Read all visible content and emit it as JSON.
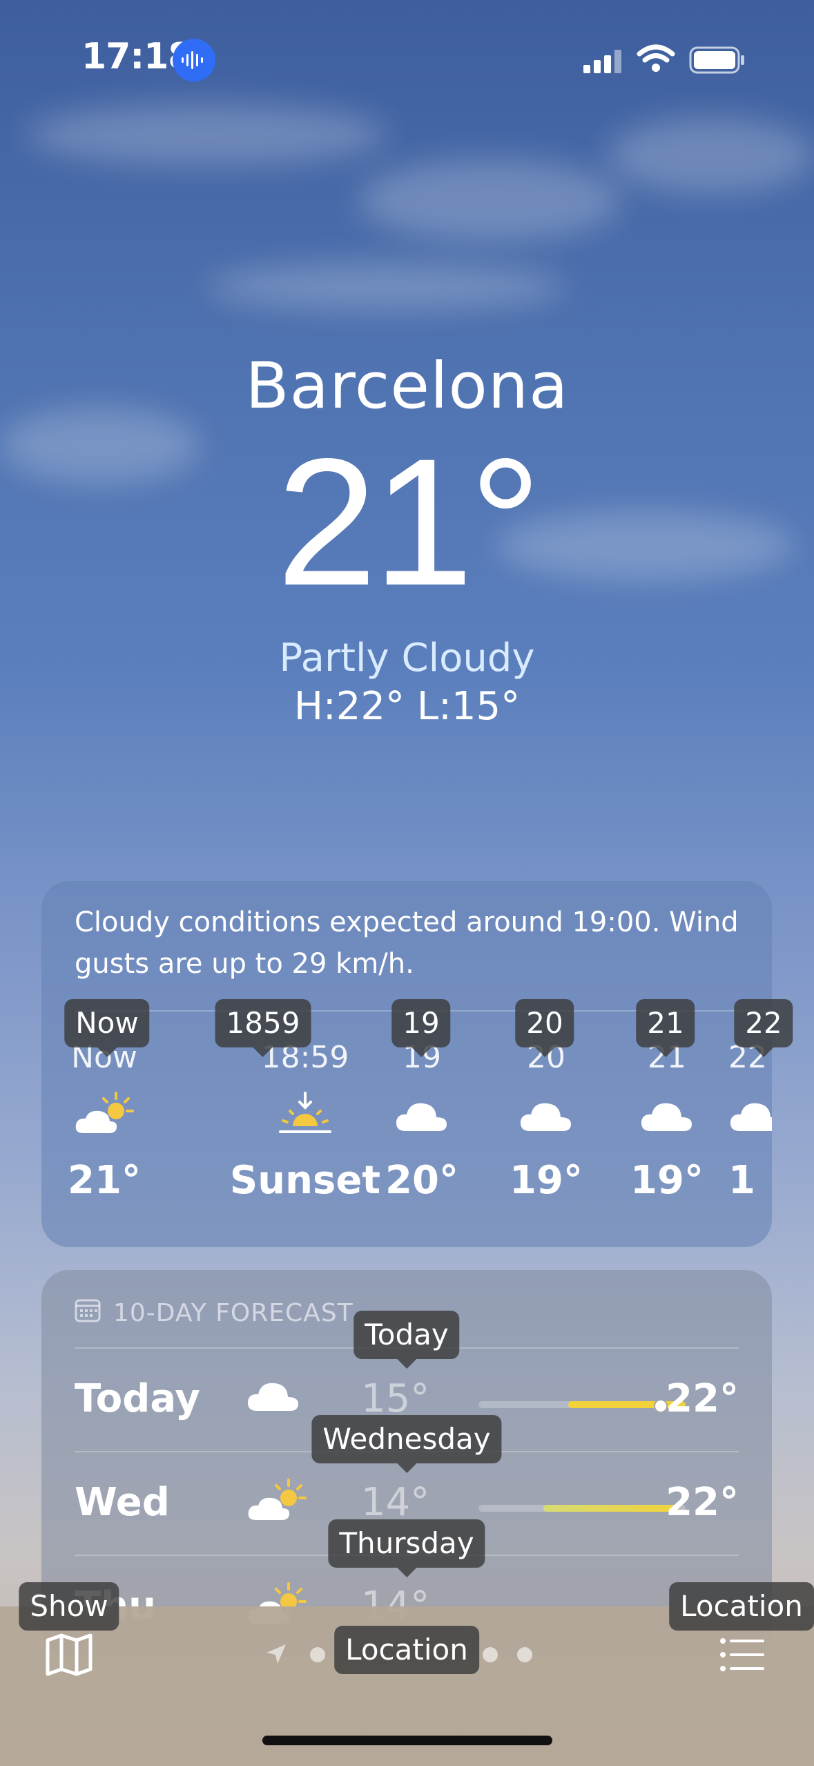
{
  "status_bar": {
    "time": "17:18",
    "icons": [
      "voice-recording-icon",
      "cellular-signal-icon",
      "wifi-icon",
      "battery-icon"
    ]
  },
  "header": {
    "city": "Barcelona",
    "temperature": "21°",
    "condition": "Partly Cloudy",
    "high_low": "H:22°  L:15°"
  },
  "hourly": {
    "summary": "Cloudy conditions expected around 19:00. Wind gusts are up to 29 km/h.",
    "items": [
      {
        "label": "Now",
        "icon": "partly-cloudy-icon",
        "temp": "21°"
      },
      {
        "label": "18:59",
        "icon": "sunset-icon",
        "temp": "Sunset"
      },
      {
        "label": "19",
        "icon": "cloud-icon",
        "temp": "20°"
      },
      {
        "label": "20",
        "icon": "cloud-icon",
        "temp": "19°"
      },
      {
        "label": "21",
        "icon": "cloud-icon",
        "temp": "19°"
      },
      {
        "label": "22",
        "icon": "cloud-icon",
        "temp": "1"
      }
    ],
    "tooltips": [
      "Now",
      "1859",
      "19",
      "20",
      "21",
      "22"
    ]
  },
  "forecast": {
    "title": "10-DAY FORECAST",
    "icon": "calendar-icon",
    "rows": [
      {
        "day": "Today",
        "icon": "cloud-icon",
        "low": "15°",
        "high": "22°",
        "tooltip": "Today"
      },
      {
        "day": "Wed",
        "icon": "partly-cloudy-icon",
        "low": "14°",
        "high": "22°",
        "tooltip": "Wednesday"
      },
      {
        "day": "Thu",
        "icon": "partly-cloudy-icon",
        "low": "14°",
        "high": "",
        "tooltip": "Thursday"
      }
    ]
  },
  "toolbar": {
    "map_tooltip": "Show",
    "location_tooltip": "Location",
    "list_tooltip": "Location",
    "icons": [
      "map-icon",
      "location-arrow-icon",
      "list-icon"
    ]
  },
  "colors": {
    "accent_blue": "#2f6df6",
    "condition_text": "#d9ecff",
    "temp_bar_yellow": "#f2d23a",
    "temp_bar_green": "#d6dc74"
  }
}
